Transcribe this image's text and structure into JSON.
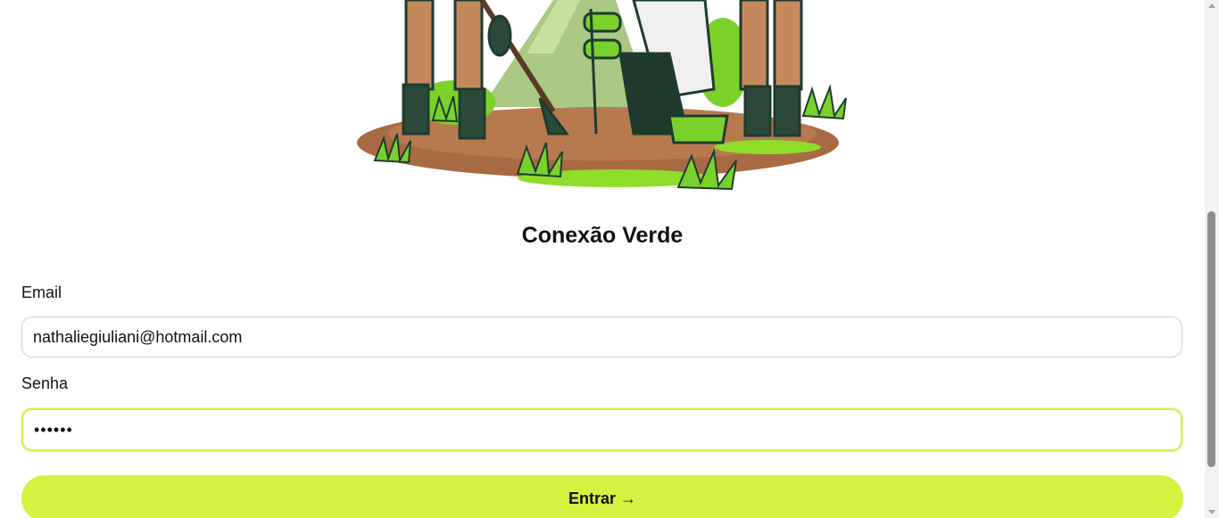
{
  "app": {
    "title": "Conexão Verde"
  },
  "illustration": {
    "icon": "tree-planting-illustration"
  },
  "form": {
    "email_label": "Email",
    "email_value": "nathaliegiuliani@hotmail.com",
    "password_label": "Senha",
    "password_value": "••••••",
    "submit_label": "Entrar →"
  },
  "colors": {
    "accent": "#d4f23f",
    "focus_border": "#d6f04a"
  }
}
